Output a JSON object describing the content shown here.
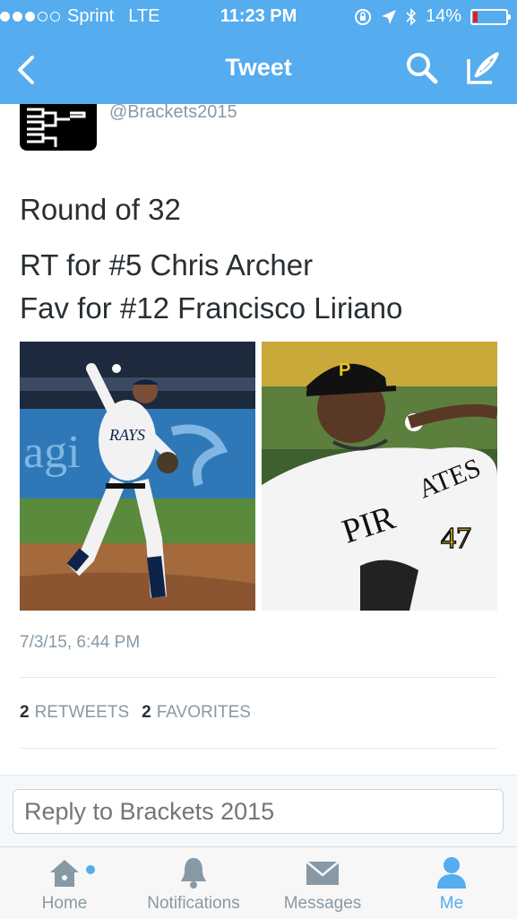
{
  "status_bar": {
    "carrier": "Sprint",
    "network": "LTE",
    "time": "11:23 PM",
    "battery_percent": "14%",
    "battery_level": 0.14,
    "battery_color": "#e0201f",
    "signal_bars": 3
  },
  "nav": {
    "title": "Tweet",
    "back_icon": "chevron-left-icon",
    "search_icon": "search-icon",
    "compose_icon": "compose-icon"
  },
  "tweet": {
    "handle": "@Brackets2015",
    "lines": [
      "Round of 32",
      "RT for #5 Chris Archer",
      "Fav for #12 Francisco Liriano"
    ],
    "timestamp": "7/3/15, 6:44 PM",
    "retweets_count": "2",
    "retweets_label": "RETWEETS",
    "favorites_count": "2",
    "favorites_label": "FAVORITES"
  },
  "reply": {
    "placeholder": "Reply to Brackets 2015"
  },
  "tabs": [
    {
      "label": "Home",
      "icon": "home-icon"
    },
    {
      "label": "Notifications",
      "icon": "bell-icon"
    },
    {
      "label": "Messages",
      "icon": "envelope-icon"
    },
    {
      "label": "Me",
      "icon": "person-icon"
    }
  ],
  "colors": {
    "accent": "#55acee",
    "muted": "#8899a6",
    "text": "#292f33"
  }
}
